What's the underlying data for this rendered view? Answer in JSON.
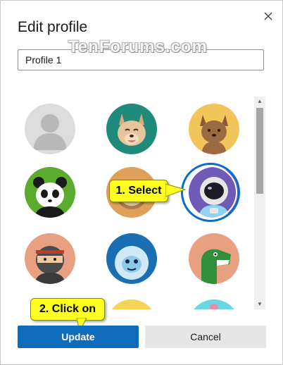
{
  "dialog": {
    "title": "Edit profile",
    "watermark": "TenForums.com",
    "name_input": {
      "value": "Profile 1",
      "placeholder": ""
    },
    "selected_avatar": "astronaut",
    "avatars": [
      {
        "name": "default-person",
        "color": "#dcdcdc"
      },
      {
        "name": "dog",
        "color": "#1f8a7a"
      },
      {
        "name": "cat",
        "color": "#f2c55a"
      },
      {
        "name": "panda",
        "color": "#5aab2e"
      },
      {
        "name": "sloth",
        "color": "#e0a05a"
      },
      {
        "name": "astronaut",
        "color": "#6f5bb6"
      },
      {
        "name": "ninja",
        "color": "#e8a081"
      },
      {
        "name": "yeti",
        "color": "#1a6fb4"
      },
      {
        "name": "dinosaur",
        "color": "#e8a081"
      },
      {
        "name": "partial-yellow",
        "color": "#f2d45a"
      },
      {
        "name": "partial-cyan",
        "color": "#6ad6e6"
      }
    ],
    "callouts": {
      "select": "1. Select",
      "update": "2. Click on"
    },
    "buttons": {
      "update": "Update",
      "cancel": "Cancel"
    },
    "colors": {
      "accent": "#0f6cbd",
      "callout": "#ffff1e",
      "selection_ring": "#0a6cc9"
    }
  }
}
